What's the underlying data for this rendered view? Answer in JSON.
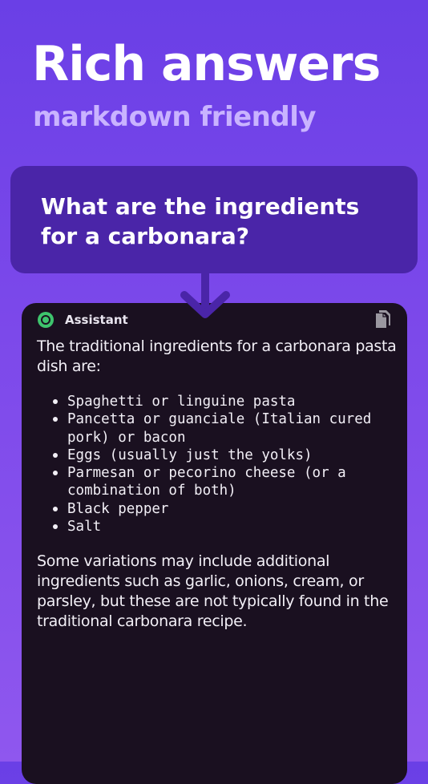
{
  "headline": "Rich answers",
  "subheadline": "markdown friendly",
  "question": "What are the ingredients for a carbonara?",
  "answer": {
    "sender_label": "Assistant",
    "intro": "The traditional ingredients for a carbonara pasta dish are:",
    "ingredients": [
      "Spaghetti or linguine pasta",
      "Pancetta or guanciale (Italian cured pork) or bacon",
      "Eggs (usually just the yolks)",
      "Parmesan or pecorino cheese (or a combination of both)",
      "Black pepper",
      "Salt"
    ],
    "outro": "Some variations may include additional ingredients such as garlic, onions, cream, or parsley, but these are not typically found in the traditional carbonara recipe."
  },
  "icons": {
    "assistant": "assistant-avatar-icon",
    "copy": "copy-icon",
    "arrow": "arrow-down-icon"
  },
  "colors": {
    "background_top": "#6a3fe6",
    "background_bottom": "#8f57ee",
    "question_card": "#4a25a8",
    "answer_card": "#1a1020",
    "assistant_icon": "#3ec46d",
    "subheadline": "#c9b3ff"
  }
}
